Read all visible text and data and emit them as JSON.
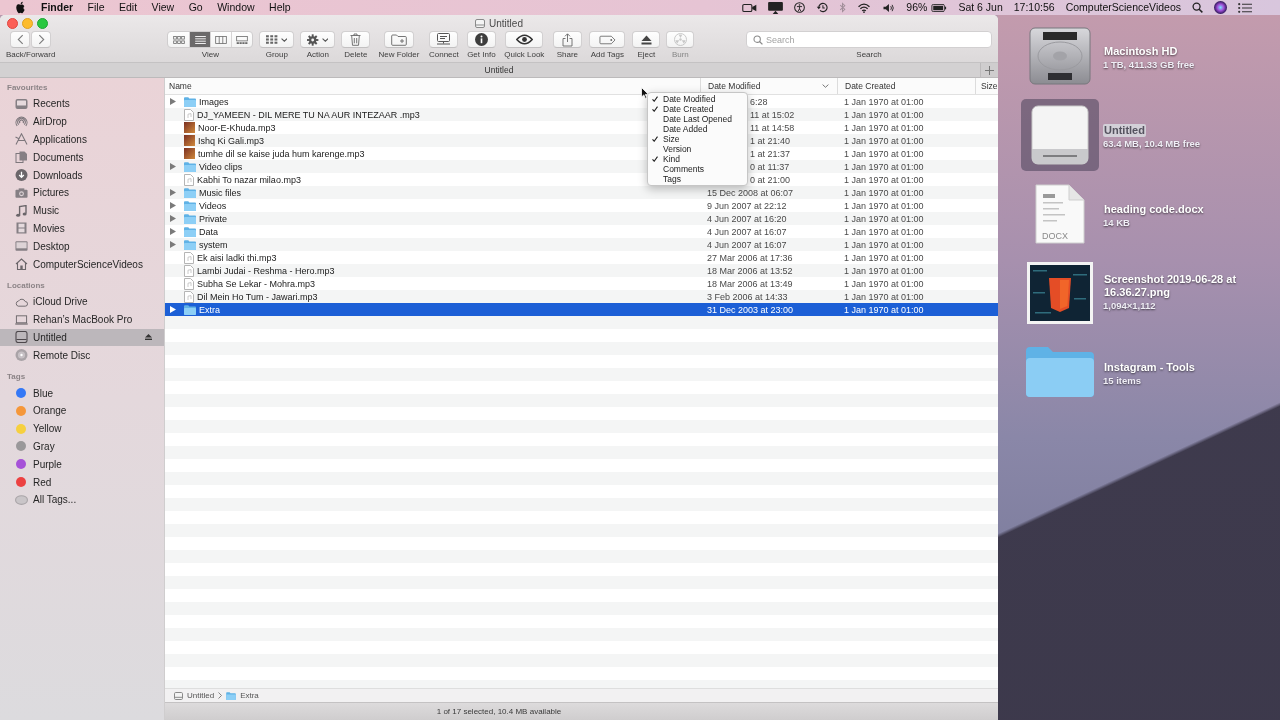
{
  "menu_bar": {
    "menus": [
      "Finder",
      "File",
      "Edit",
      "View",
      "Go",
      "Window",
      "Help"
    ],
    "battery": "96%",
    "date": "Sat 6 Jun",
    "time": "17:10:56",
    "user": "ComputerScienceVideos"
  },
  "window": {
    "title": "Untitled"
  },
  "toolbar": {
    "items": [
      {
        "kind": "nav",
        "label": "Back/Forward",
        "disabled": false
      },
      {
        "kind": "view",
        "label": "View",
        "disabled": false,
        "segments": [
          {
            "selected": false
          },
          {
            "selected": true
          },
          {
            "selected": false
          },
          {
            "selected": false
          }
        ]
      },
      {
        "kind": "menu",
        "label": "Group",
        "disabled": false
      },
      {
        "kind": "menu",
        "label": "Action",
        "disabled": false
      },
      {
        "kind": "button",
        "label": "Delete",
        "disabled": false
      },
      {
        "kind": "button",
        "label": "New Folder",
        "disabled": false
      },
      {
        "kind": "button",
        "label": "Connect",
        "disabled": false
      },
      {
        "kind": "button",
        "label": "Get Info",
        "disabled": false
      },
      {
        "kind": "button",
        "label": "Quick Look",
        "disabled": false
      },
      {
        "kind": "button",
        "label": "Share",
        "disabled": false
      },
      {
        "kind": "button",
        "label": "Add Tags",
        "disabled": false
      },
      {
        "kind": "button",
        "label": "Eject",
        "disabled": false
      },
      {
        "kind": "button",
        "label": "Burn",
        "disabled": true
      },
      {
        "kind": "search",
        "label": "Search",
        "placeholder": "Search",
        "disabled": false
      }
    ]
  },
  "tabs": [
    {
      "label": "Untitled",
      "selected": true
    }
  ],
  "sidebar": {
    "sections": [
      {
        "heading": "Favourites",
        "items": [
          {
            "label": "Recents",
            "selected": false
          },
          {
            "label": "AirDrop",
            "selected": false
          },
          {
            "label": "Applications",
            "selected": false
          },
          {
            "label": "Documents",
            "selected": false
          },
          {
            "label": "Downloads",
            "selected": false
          },
          {
            "label": "Pictures",
            "selected": false
          },
          {
            "label": "Music",
            "selected": false
          },
          {
            "label": "Movies",
            "selected": false
          },
          {
            "label": "Desktop",
            "selected": false
          },
          {
            "label": "ComputerScienceVideos",
            "selected": false
          }
        ]
      },
      {
        "heading": "Locations",
        "items": [
          {
            "label": "iCloud Drive",
            "selected": false,
            "eject": false
          },
          {
            "label": "Rehan’s MacBook Pro",
            "selected": false,
            "eject": false
          },
          {
            "label": "Untitled",
            "selected": true,
            "eject": true
          },
          {
            "label": "Remote Disc",
            "selected": false,
            "eject": false
          }
        ]
      },
      {
        "heading": "Tags",
        "items": [
          {
            "label": "Blue",
            "selected": false,
            "color": "#3478f6"
          },
          {
            "label": "Orange",
            "selected": false,
            "color": "#f5973a"
          },
          {
            "label": "Yellow",
            "selected": false,
            "color": "#f6d03f"
          },
          {
            "label": "Gray",
            "selected": false,
            "color": "#9a989a"
          },
          {
            "label": "Purple",
            "selected": false,
            "color": "#a652d8"
          },
          {
            "label": "Red",
            "selected": false,
            "color": "#ec4141"
          },
          {
            "label": "All Tags...",
            "selected": false
          }
        ]
      }
    ]
  },
  "file_list": {
    "columns": [
      {
        "label": "Name",
        "sorted": false
      },
      {
        "label": "Date Modified",
        "sorted": true
      },
      {
        "label": "Date Created",
        "sorted": false
      },
      {
        "label": "Size",
        "sorted": false
      }
    ],
    "rows": [
      {
        "kind": "folder",
        "name": "Images",
        "expanded": false,
        "date_modified": "6:28",
        "date_created": "1 Jan 1970 at 01:00",
        "selected": false
      },
      {
        "kind": "audio",
        "name": "DJ_YAMEEN - DIL MERE TU NA AUR INTEZAAR .mp3",
        "date_modified": "11 at 15:02",
        "date_created": "1 Jan 1970 at 01:00",
        "selected": false
      },
      {
        "kind": "artwork",
        "name": "Noor-E-Khuda.mp3",
        "date_modified": "11 at 14:58",
        "date_created": "1 Jan 1970 at 01:00",
        "selected": false
      },
      {
        "kind": "artwork",
        "name": "Ishq Ki Gali.mp3",
        "date_modified": "1 at 21:40",
        "date_created": "1 Jan 1970 at 01:00",
        "selected": false
      },
      {
        "kind": "artwork",
        "name": "tumhe dil se kaise juda hum karenge.mp3",
        "date_modified": "1 at 21:37",
        "date_created": "1 Jan 1970 at 01:00",
        "selected": false
      },
      {
        "kind": "folder",
        "name": "Video clips",
        "expanded": false,
        "date_modified": "0 at 11:37",
        "date_created": "1 Jan 1970 at 01:00",
        "selected": false
      },
      {
        "kind": "audio",
        "name": "Kabhi To nazar milao.mp3",
        "date_modified": "0 at 21:00",
        "date_created": "1 Jan 1970 at 01:00",
        "selected": false
      },
      {
        "kind": "folder",
        "name": "Music files",
        "expanded": false,
        "date_modified": "15 Dec 2008 at 06:07",
        "date_created": "1 Jan 1970 at 01:00",
        "selected": false
      },
      {
        "kind": "folder",
        "name": "Videos",
        "expanded": false,
        "date_modified": "9 Jun 2007 at 22:12",
        "date_created": "1 Jan 1970 at 01:00",
        "selected": false
      },
      {
        "kind": "folder",
        "name": "Private",
        "expanded": false,
        "date_modified": "4 Jun 2007 at 16:20",
        "date_created": "1 Jan 1970 at 01:00",
        "selected": false
      },
      {
        "kind": "folder",
        "name": "Data",
        "expanded": false,
        "date_modified": "4 Jun 2007 at 16:07",
        "date_created": "1 Jan 1970 at 01:00",
        "selected": false
      },
      {
        "kind": "folder",
        "name": "system",
        "expanded": false,
        "date_modified": "4 Jun 2007 at 16:07",
        "date_created": "1 Jan 1970 at 01:00",
        "selected": false
      },
      {
        "kind": "audio",
        "name": "Ek aisi ladki thi.mp3",
        "date_modified": "27 Mar 2006 at 17:36",
        "date_created": "1 Jan 1970 at 01:00",
        "selected": false
      },
      {
        "kind": "audio",
        "name": "Lambi Judai - Reshma - Hero.mp3",
        "date_modified": "18 Mar 2006 at 13:52",
        "date_created": "1 Jan 1970 at 01:00",
        "selected": false
      },
      {
        "kind": "audio",
        "name": "Subha Se Lekar - Mohra.mp3",
        "date_modified": "18 Mar 2006 at 13:49",
        "date_created": "1 Jan 1970 at 01:00",
        "selected": false
      },
      {
        "kind": "audio",
        "name": "Dil Mein Ho Tum - Jawari.mp3",
        "date_modified": "3 Feb 2006 at 14:33",
        "date_created": "1 Jan 1970 at 01:00",
        "selected": false
      },
      {
        "kind": "folder",
        "name": "Extra",
        "expanded": false,
        "date_modified": "31 Dec 2003 at 23:00",
        "date_created": "1 Jan 1970 at 01:00",
        "selected": true
      }
    ],
    "column_menu": {
      "items": [
        {
          "label": "Date Modified",
          "checked": true
        },
        {
          "label": "Date Created",
          "checked": true
        },
        {
          "label": "Date Last Opened",
          "checked": false
        },
        {
          "label": "Date Added",
          "checked": false
        },
        {
          "label": "Size",
          "checked": true
        },
        {
          "label": "Version",
          "checked": false
        },
        {
          "label": "Kind",
          "checked": true
        },
        {
          "label": "Comments",
          "checked": false
        },
        {
          "label": "Tags",
          "checked": false
        }
      ]
    }
  },
  "path_bar": [
    {
      "kind": "drive",
      "label": "Untitled"
    },
    {
      "kind": "folder",
      "label": "Extra"
    }
  ],
  "status_bar": "1 of 17 selected, 10.4 MB available",
  "desktop": {
    "items": [
      {
        "kind": "hard_drive",
        "name": "Macintosh HD",
        "info": "1 TB, 411.33 GB free",
        "selected": false
      },
      {
        "kind": "external_drive",
        "name": "Untitled",
        "info": "63.4 MB, 10.4 MB free",
        "selected": true
      },
      {
        "kind": "document",
        "name": "heading code.docx",
        "info": "14 KB",
        "icon_label": "DOCX",
        "selected": false
      },
      {
        "kind": "image",
        "name": "Screenshot 2019-06-28 at 16.36.27.png",
        "info": "1,094×1,112",
        "selected": false
      },
      {
        "kind": "folder",
        "name": "Instagram - Tools",
        "info": "15 items",
        "selected": false
      }
    ]
  }
}
